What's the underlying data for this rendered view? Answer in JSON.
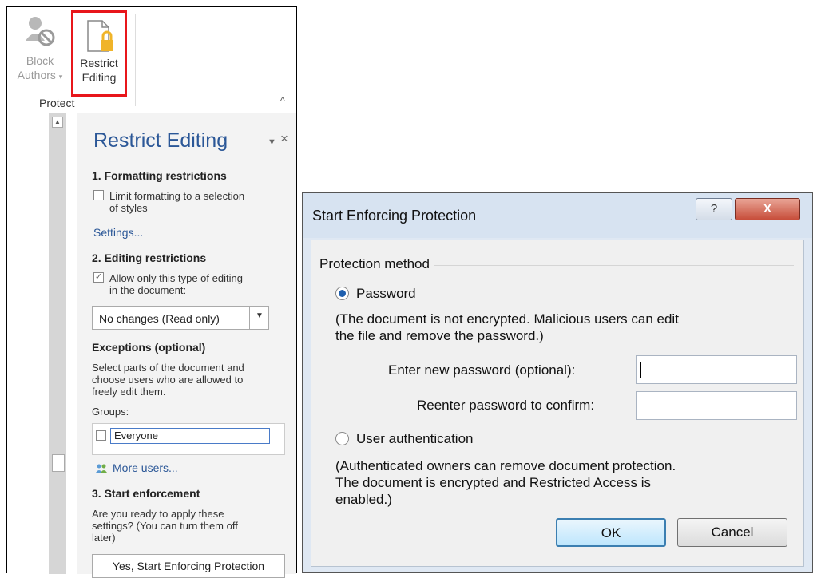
{
  "ribbon": {
    "block_label_1": "Block",
    "block_label_2": "Authors",
    "restrict_label_1": "Restrict",
    "restrict_label_2": "Editing",
    "group_label": "Protect"
  },
  "pane": {
    "title": "Restrict Editing",
    "section1": "1. Formatting restrictions",
    "limit_formatting_1": "Limit formatting to a selection",
    "limit_formatting_2": "of styles",
    "settings_link": "Settings...",
    "section2": "2. Editing restrictions",
    "allow_only_1": "Allow only this type of editing",
    "allow_only_2": "in the document:",
    "editing_type": "No changes (Read only)",
    "exceptions_heading": "Exceptions (optional)",
    "exceptions_text_1": "Select parts of the document and",
    "exceptions_text_2": "choose users who are allowed to",
    "exceptions_text_3": "freely edit them.",
    "groups_label": "Groups:",
    "everyone": "Everyone",
    "more_users": "More users...",
    "section3": "3. Start enforcement",
    "ready_text_1": "Are you ready to apply these",
    "ready_text_2": "settings? (You can turn them off",
    "ready_text_3": "later)",
    "start_button": "Yes, Start Enforcing Protection"
  },
  "dialog": {
    "title": "Start Enforcing Protection",
    "help": "?",
    "close": "X",
    "protection_method": "Protection method",
    "password_option": "Password",
    "password_note_1": "(The document is not encrypted. Malicious users can edit",
    "password_note_2": "the file and remove the password.)",
    "new_password_label": "Enter new password (optional):",
    "reenter_label": "Reenter password to confirm:",
    "user_auth_option": "User authentication",
    "auth_note_1": "(Authenticated owners can remove document protection.",
    "auth_note_2": "The document is encrypted and Restricted Access is",
    "auth_note_3": "enabled.)",
    "ok": "OK",
    "cancel": "Cancel"
  },
  "colors": {
    "accent_blue": "#2b5797",
    "highlight_red": "#e8161b",
    "close_red": "#c74d3a"
  }
}
